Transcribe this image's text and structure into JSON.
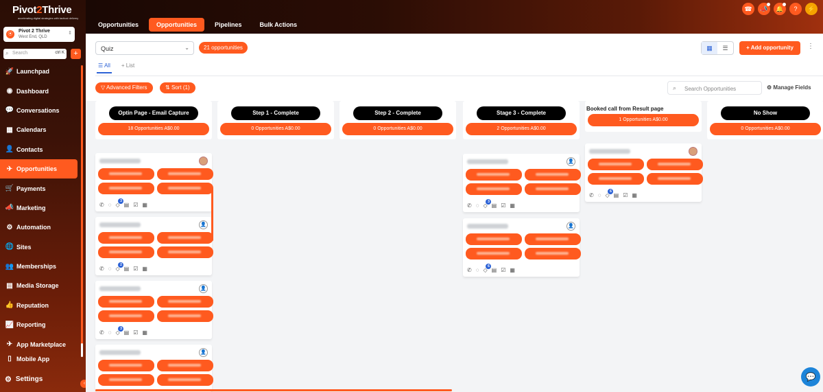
{
  "brand": {
    "logo_left": "Pivot",
    "logo_accent": "2",
    "logo_right": "Thrive",
    "tagline": "accelerating digital strategies with tactical delivery"
  },
  "account": {
    "name": "Pivot 2 Thrive",
    "location": "West End, QLD",
    "initial": "⦿"
  },
  "search": {
    "placeholder": "Search",
    "shortcut": "ctrl K",
    "add": "+"
  },
  "nav": [
    {
      "label": "Launchpad",
      "icon": "🚀"
    },
    {
      "label": "Dashboard",
      "icon": "◉"
    },
    {
      "label": "Conversations",
      "icon": "💬"
    },
    {
      "label": "Calendars",
      "icon": "▦"
    },
    {
      "label": "Contacts",
      "icon": "👤"
    },
    {
      "label": "Opportunities",
      "icon": "✈"
    },
    {
      "label": "Payments",
      "icon": "🛒"
    },
    {
      "label": "Marketing",
      "icon": "📣"
    },
    {
      "label": "Automation",
      "icon": "⚙"
    },
    {
      "label": "Sites",
      "icon": "🌐"
    },
    {
      "label": "Memberships",
      "icon": "👥"
    },
    {
      "label": "Media Storage",
      "icon": "▤"
    },
    {
      "label": "Reputation",
      "icon": "👍"
    },
    {
      "label": "Reporting",
      "icon": "📈"
    },
    {
      "label": "App Marketplace",
      "icon": "✈"
    },
    {
      "label": "Mobile App",
      "icon": "▯"
    }
  ],
  "settings": {
    "label": "Settings",
    "icon": "⚙"
  },
  "tabs": [
    "Opportunities",
    "Opportunities",
    "Pipelines",
    "Bulk Actions"
  ],
  "top_icons": [
    "☎",
    "📣",
    "🔔",
    "?",
    "⚡"
  ],
  "toolbar": {
    "pipeline": "Quiz",
    "count": "21 opportunities",
    "add_label": "+ Add opportunity",
    "more": "⋮",
    "view_all": "All",
    "view_list": "+ List",
    "advanced_filters": "Advanced Filters",
    "sort": "Sort (1)",
    "search_placeholder": "Search Opportunities",
    "manage_fields": "Manage Fields"
  },
  "columns": [
    {
      "title": "Optin Page - Email Capture",
      "summary": "18 Opportunities    A$0.00",
      "style": "pill"
    },
    {
      "title": "Step 1 - Complete",
      "summary": "0 Opportunities    A$0.00",
      "style": "pill"
    },
    {
      "title": "Step 2 - Complete",
      "summary": "0 Opportunities    A$0.00",
      "style": "pill"
    },
    {
      "title": "Stage 3 - Complete",
      "summary": "2 Opportunities    A$0.00",
      "style": "pill"
    },
    {
      "title": "Booked call from Result page",
      "summary": "1 Opportunities    A$0.00",
      "style": "plain"
    },
    {
      "title": "No Show",
      "summary": "0 Opportunities    A$0.00",
      "style": "pill"
    }
  ],
  "card_badges": {
    "col1": [
      "3",
      "2",
      "3"
    ],
    "col4": [
      "3",
      "6"
    ],
    "col5": [
      "6"
    ]
  }
}
